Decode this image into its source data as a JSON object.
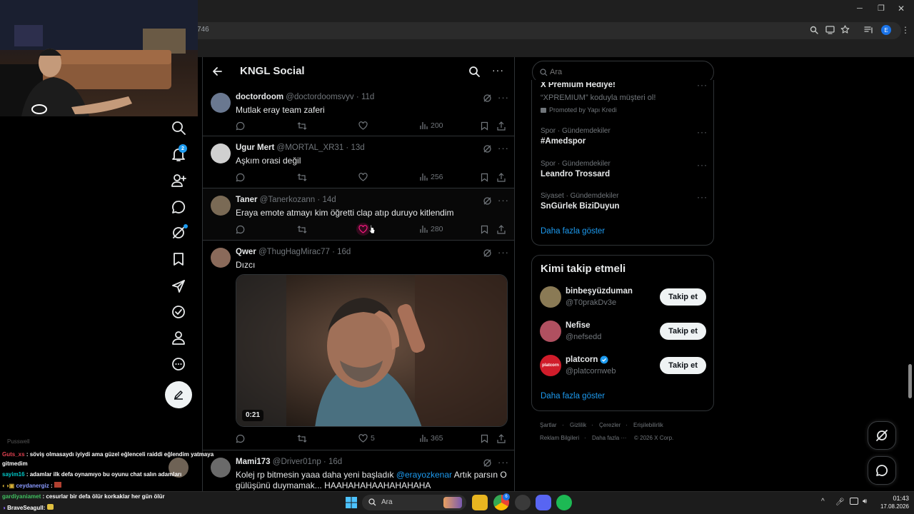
{
  "browser": {
    "url_fragment": "746",
    "window_controls": [
      "minimize-icon",
      "restore-icon",
      "close-icon"
    ]
  },
  "nav": {
    "notification_count": "2",
    "items": [
      "search-icon",
      "bell-icon",
      "follow-icon",
      "chat-icon",
      "grok-icon",
      "bookmark-icon",
      "rocket-icon",
      "verified-icon",
      "profile-icon",
      "more-circle-icon",
      "compose-icon"
    ]
  },
  "timeline": {
    "title": "KNGL Social",
    "posts": [
      {
        "name": "doctordoom",
        "handle": "@doctordoomsvyv",
        "time": "11d",
        "text": "Mutlak eray team zaferi",
        "likes": "",
        "views": "200",
        "avatar_color": "#6a7890"
      },
      {
        "name": "Ugur Mert",
        "handle": "@MORTAL_XR31",
        "time": "13d",
        "text": "Aşkım orasi değil",
        "likes": "",
        "views": "256",
        "avatar_color": "#c8c8c8"
      },
      {
        "name": "Taner",
        "handle": "@Tanerkozann",
        "time": "14d",
        "text": "Eraya emote atmayı kim öğretti clap atıp duruyo kitlendim",
        "likes": "",
        "views": "280",
        "avatar_color": "#7a6a55"
      },
      {
        "name": "Qwer",
        "handle": "@ThugHagMirac77",
        "time": "16d",
        "text": "Dızcı",
        "likes": "5",
        "views": "365",
        "avatar_color": "#8a6a5a",
        "video_duration": "0:21"
      },
      {
        "name": "Mami173",
        "handle": "@Driver01np",
        "time": "16d",
        "text": "Kolej rp bitmesin yaaa daha yeni başladık",
        "mention": "@erayozkenar",
        "text_after": "Artık parsın O",
        "text_line2": "gülüşünü duymamak... HAAHAHAHAAHAHAHAHA",
        "avatar_color": "#6a6a6a"
      }
    ]
  },
  "search": {
    "placeholder": "Ara"
  },
  "trends": {
    "promo_title": "X Premium Hediye!",
    "promo_text": "“XPREMIUM” koduyla müşteri ol!",
    "promo_by": "Promoted by Yapı Kredi",
    "items": [
      {
        "category": "Spor · Gündemdekiler",
        "name": "#Amedspor"
      },
      {
        "category": "Spor · Gündemdekiler",
        "name": "Leandro Trossard"
      },
      {
        "category": "Siyaset · Gündemdekiler",
        "name": "SnGürlek BiziDuyun"
      }
    ],
    "show_more": "Daha fazla göster"
  },
  "who_to_follow": {
    "title": "Kimi takip etmeli",
    "users": [
      {
        "name": "binbeşyüzduman",
        "handle": "@T0prakDv3e",
        "button": "Takip et",
        "avatar_color": "#8a7a55"
      },
      {
        "name": "Nefise",
        "handle": "@nefsedd",
        "button": "Takip et",
        "avatar_color": "#b05060"
      },
      {
        "name": "platcorn",
        "handle": "@platcornweb",
        "button": "Takip et",
        "avatar_color": "#d01c2a",
        "avatar_text": "platcorn"
      }
    ],
    "show_more": "Daha fazla göster"
  },
  "footer": {
    "links": [
      "Şartlar",
      "Gizlilik",
      "Çerezler",
      "Erişilebilirlik",
      "Reklam Bilgileri",
      "Daha fazla ···"
    ],
    "copyright": "© 2026 X Corp."
  },
  "chat": {
    "header": "Pusswell",
    "lines": [
      {
        "user": "Guts_xs",
        "color": "#e04050",
        "msg": ": söviş olmasaydı iyiydi ama güzel eğlenceli raiddi eğlendim yatmaya"
      },
      {
        "user": "",
        "color": "#ffffff",
        "msg": "gitmedim"
      },
      {
        "user": "sayim16",
        "color": "#00c8c8",
        "msg": ": adamlar ilk defa oynamıyo bu oyunu chat salın adamları"
      },
      {
        "user": "ceydanergiz",
        "color": "#8a9aff",
        "msg": ":"
      },
      {
        "user": "gardiyaniamet",
        "color": "#40c060",
        "msg": ": cesurlar bir defa ölür korkaklar her gün ölür"
      },
      {
        "user": "BraveSeagull",
        "color": "#ffffff",
        "msg": ":"
      }
    ]
  },
  "taskbar": {
    "search_placeholder": "Ara",
    "time": "01:43",
    "date": "17.08.2026",
    "badge": "6"
  }
}
